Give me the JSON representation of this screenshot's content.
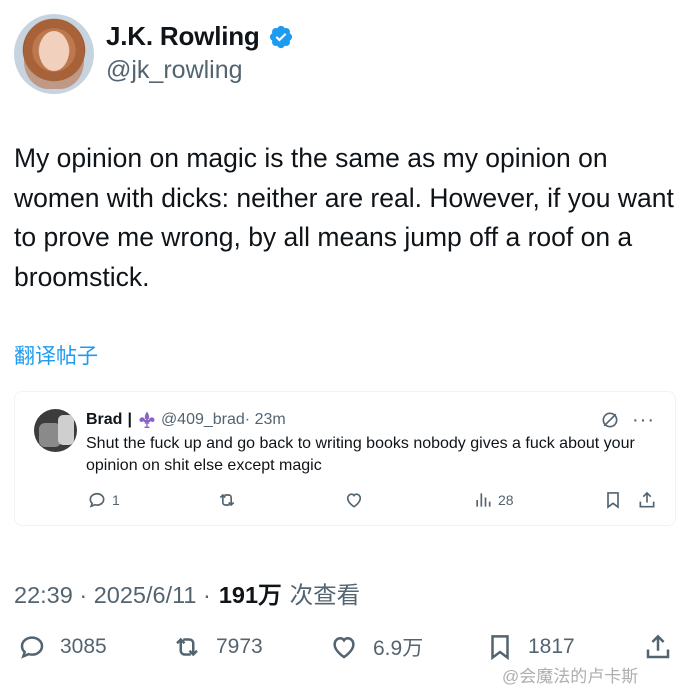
{
  "author": {
    "display_name": "J.K. Rowling",
    "handle": "@jk_rowling",
    "verified": true,
    "verified_color": "#1d9bf0"
  },
  "tweet": {
    "text": "My opinion on magic is the same as my opinion on women with dicks: neither are real. However, if you want to prove me wrong, by all means jump off a roof on a broomstick.",
    "translate_label": "翻译帖子"
  },
  "quoted_reply": {
    "name": "Brad",
    "separator": "|",
    "handle": "@409_brad",
    "time": "· 23m",
    "text": "Shut the fuck up and go back to writing books nobody gives a fuck about your opinion on shit else except magic",
    "replies": "1",
    "views": "28",
    "emblem_icon": "fleur-de-lis-icon"
  },
  "meta": {
    "time": "22:39 · 2025/6/11 · ",
    "views": "191万",
    "views_label": "次查看"
  },
  "actions": {
    "replies": "3085",
    "reposts": "7973",
    "likes": "6.9万",
    "bookmarks": "1817"
  },
  "watermark": "@会魔法的卢卡斯",
  "colors": {
    "text": "#0f1419",
    "secondary": "#536471",
    "link": "#1d9bf0"
  }
}
